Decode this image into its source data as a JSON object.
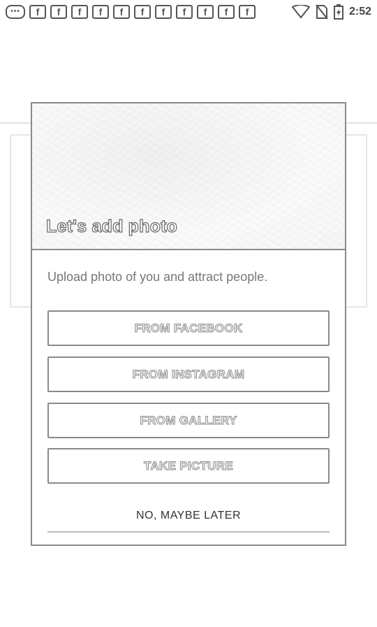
{
  "status_bar": {
    "notifications": [
      "chat",
      "f",
      "f",
      "f",
      "f",
      "f",
      "f",
      "f",
      "f",
      "f",
      "f",
      "f"
    ],
    "notification_icon_names": {
      "chat": "message-notification-icon",
      "f": "facebook-notification-icon"
    },
    "time": "2:52"
  },
  "dialog": {
    "title": "Let's add photo",
    "subtitle": "Upload photo of you and attract people.",
    "buttons": {
      "facebook": "FROM FACEBOOK",
      "instagram": "FROM INSTAGRAM",
      "gallery": "FROM GALLERY",
      "take_picture": "TAKE PICTURE"
    },
    "later": "NO, MAYBE LATER"
  }
}
